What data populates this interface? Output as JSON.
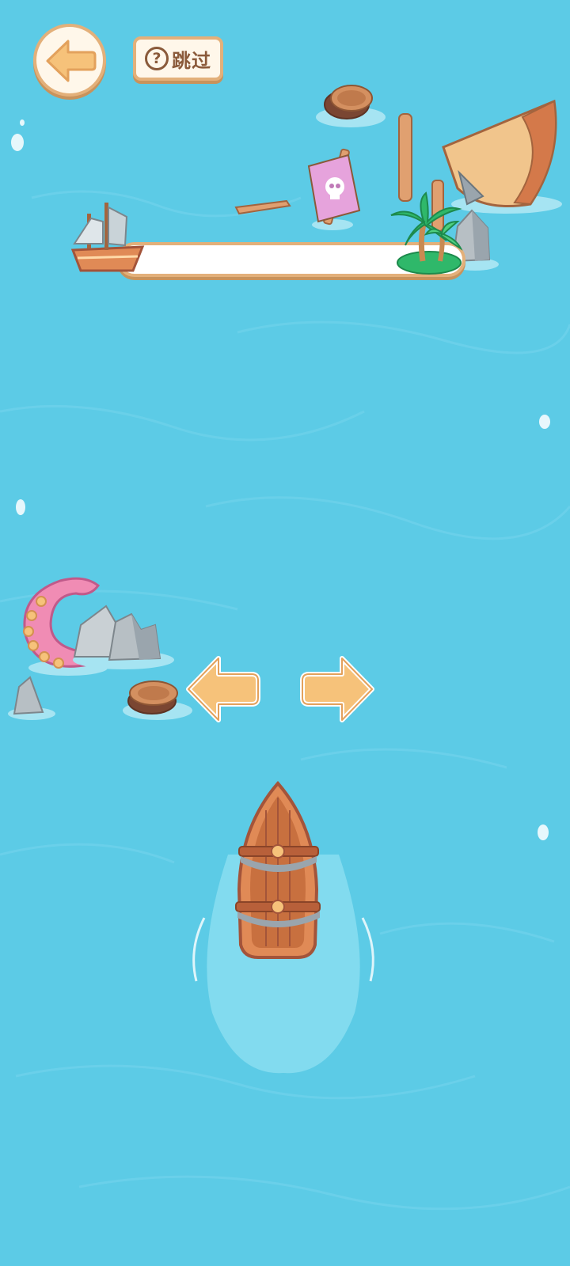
{
  "hud": {
    "back_button_icon": "left-arrow-icon",
    "skip_icon": "question-mark-icon",
    "skip_question_glyph": "?",
    "skip_label": "跳过"
  },
  "progress": {
    "value": 0,
    "start_icon": "sailing-ship-icon",
    "goal_icon": "palm-island-icon"
  },
  "controls": {
    "left_icon": "left-arrow-icon",
    "right_icon": "right-arrow-icon"
  },
  "colors": {
    "water": "#5ccbe6",
    "button_fill": "#fff7ea",
    "button_border": "#e3b07a",
    "arrow_fill": "#f6c27a",
    "boat_wood": "#d4794a",
    "tentacle": "#f08cb4"
  }
}
